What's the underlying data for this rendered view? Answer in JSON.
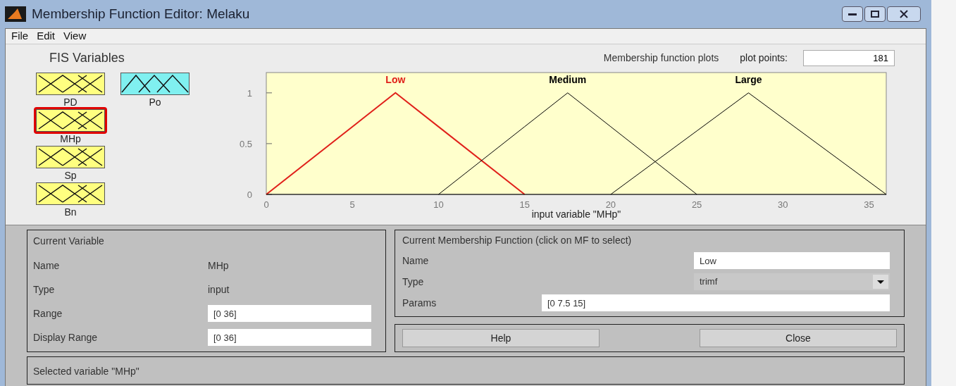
{
  "window": {
    "title": "Membership Function Editor: Melaku"
  },
  "menu": [
    "File",
    "Edit",
    "View"
  ],
  "fis_variables": {
    "title": "FIS Variables",
    "items": [
      {
        "name": "PD",
        "kind": "input",
        "selected": false
      },
      {
        "name": "Po",
        "kind": "output",
        "selected": false
      },
      {
        "name": "MHp",
        "kind": "input",
        "selected": true
      },
      {
        "name": "Sp",
        "kind": "input",
        "selected": false
      },
      {
        "name": "Bn",
        "kind": "input",
        "selected": false
      }
    ]
  },
  "plot": {
    "title": "Membership function plots",
    "plot_points_label": "plot points:",
    "plot_points": "181",
    "chart_data": {
      "type": "line",
      "xlabel": "input variable \"MHp\"",
      "x": [
        0,
        7.5,
        10,
        15,
        17.5,
        20,
        25,
        28,
        36
      ],
      "xlim": [
        0,
        36
      ],
      "ylim": [
        0,
        1.2
      ],
      "xticks": [
        0,
        5,
        10,
        15,
        20,
        25,
        30,
        35
      ],
      "yticks": [
        0,
        0.5,
        1
      ],
      "series": [
        {
          "name": "Low",
          "color": "#e0201a",
          "values": [
            0,
            1,
            0.667,
            0,
            null,
            null,
            null,
            null,
            null
          ]
        },
        {
          "name": "Medium",
          "color": "#000000",
          "values": [
            null,
            null,
            0,
            0.667,
            1,
            0.667,
            0,
            null,
            null
          ]
        },
        {
          "name": "Large",
          "color": "#000000",
          "values": [
            null,
            null,
            null,
            null,
            null,
            0,
            0.625,
            1,
            0
          ]
        }
      ]
    }
  },
  "current_variable": {
    "title": "Current Variable",
    "rows": [
      {
        "label": "Name",
        "value": "MHp",
        "kind": "text"
      },
      {
        "label": "Type",
        "value": "input",
        "kind": "text"
      },
      {
        "label": "Range",
        "value": "[0 36]",
        "kind": "field"
      },
      {
        "label": "Display Range",
        "value": "[0 36]",
        "kind": "field"
      }
    ]
  },
  "current_mf": {
    "title": "Current Membership Function (click on MF to select)",
    "name_label": "Name",
    "name": "Low",
    "type_label": "Type",
    "type": "trimf",
    "params_label": "Params",
    "params": "[0 7.5 15]"
  },
  "buttons": [
    "Help",
    "Close"
  ],
  "status": "Selected variable \"MHp\""
}
